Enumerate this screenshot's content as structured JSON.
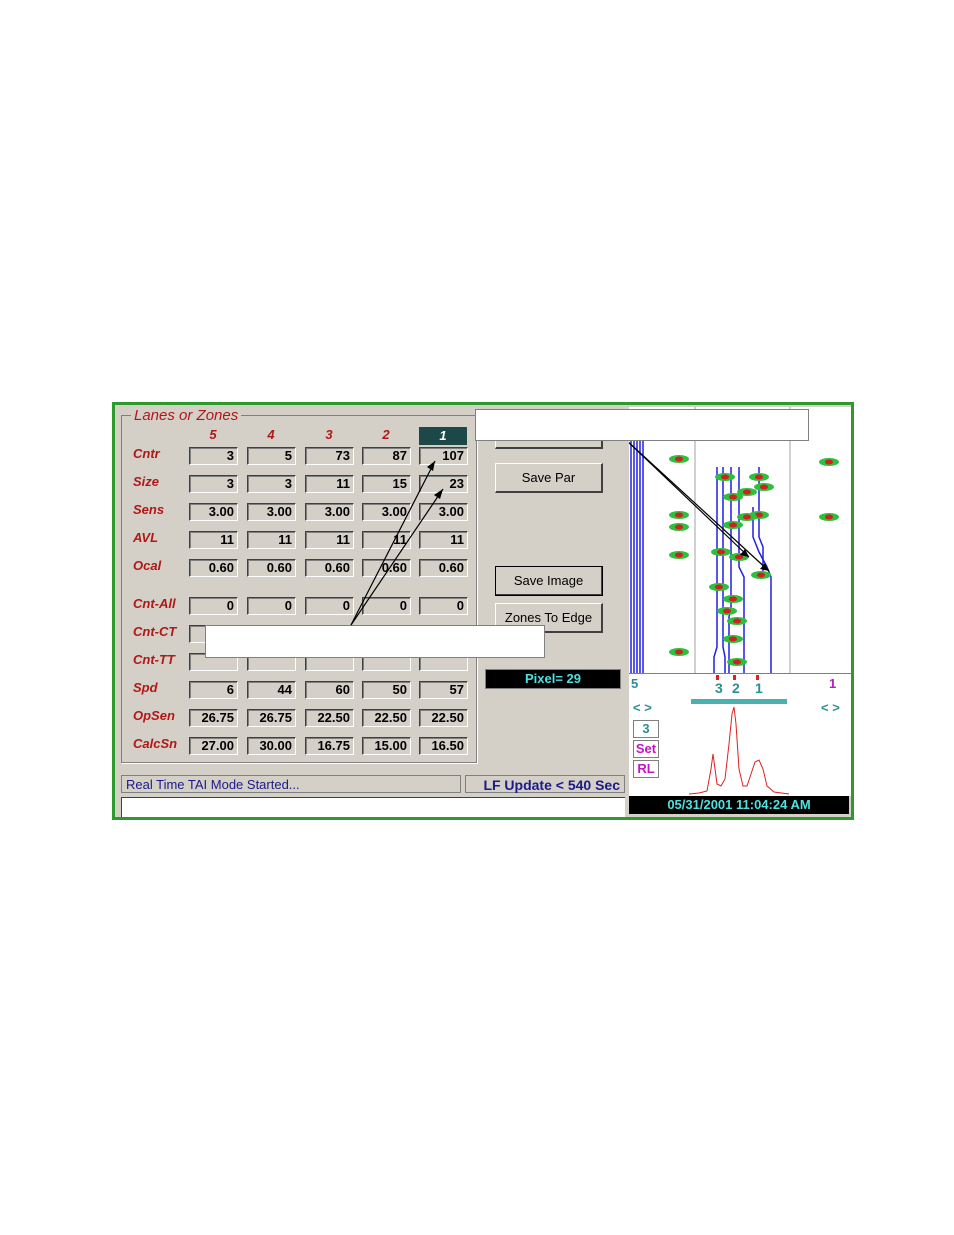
{
  "panel": {
    "group_title": "Lanes or Zones",
    "columns": [
      "5",
      "4",
      "3",
      "2",
      "1"
    ],
    "rows": [
      {
        "label": "Cntr",
        "values": [
          "3",
          "5",
          "73",
          "87",
          "107"
        ]
      },
      {
        "label": "Size",
        "values": [
          "3",
          "3",
          "11",
          "15",
          "23"
        ]
      },
      {
        "label": "Sens",
        "values": [
          "3.00",
          "3.00",
          "3.00",
          "3.00",
          "3.00"
        ]
      },
      {
        "label": "AVL",
        "values": [
          "11",
          "11",
          "11",
          "11",
          "11"
        ]
      },
      {
        "label": "Ocal",
        "values": [
          "0.60",
          "0.60",
          "0.60",
          "0.60",
          "0.60"
        ]
      },
      {
        "label": "Cnt-All",
        "values": [
          "0",
          "0",
          "0",
          "0",
          "0"
        ]
      },
      {
        "label": "Cnt-CT",
        "values": [
          "",
          "",
          "",
          "",
          ""
        ]
      },
      {
        "label": "Cnt-TT",
        "values": [
          "",
          "",
          "",
          "",
          ""
        ]
      },
      {
        "label": "Spd",
        "values": [
          "6",
          "44",
          "60",
          "50",
          "57"
        ]
      },
      {
        "label": "OpSen",
        "values": [
          "26.75",
          "26.75",
          "22.50",
          "22.50",
          "22.50"
        ]
      },
      {
        "label": "CalcSn",
        "values": [
          "27.00",
          "30.00",
          "16.75",
          "15.00",
          "16.50"
        ]
      }
    ]
  },
  "buttons": {
    "save_par": "Save Par",
    "save_image": "Save Image",
    "zones_to_edge": "Zones To Edge"
  },
  "pixel_readout": "Pixel= 29",
  "status": {
    "message": "Real Time TAI Mode Started...",
    "lf_update": "LF Update < 540 Sec",
    "input_value": ""
  },
  "viewer": {
    "zone_labels": [
      "3",
      "2",
      "1"
    ],
    "left_marker": "5",
    "right_marker": "1",
    "nav_left": "< >",
    "nav_right": "< >",
    "zone_count": "3",
    "set_label": "Set",
    "rl_label": "RL",
    "datetime": "05/31/2001 11:04:24 AM"
  },
  "colors": {
    "frame_border": "#2e9a2e",
    "label_red": "#b01818",
    "teal": "#2a8f8f",
    "magenta": "#c018c0",
    "lane_blue": "#2020e0",
    "peak_red": "#e02020"
  }
}
